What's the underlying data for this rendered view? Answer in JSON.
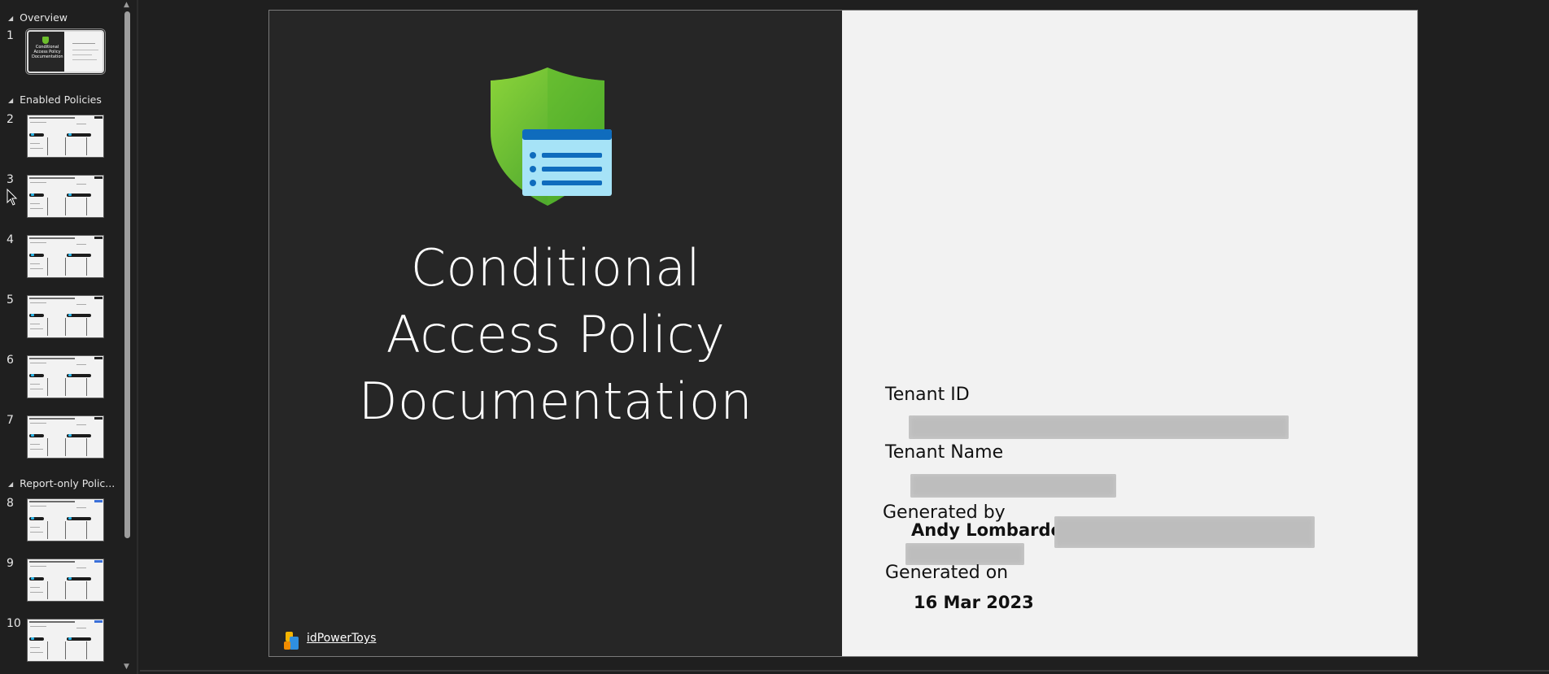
{
  "sidebar": {
    "sections": [
      {
        "label": "Overview"
      },
      {
        "label": "Enabled Policies"
      },
      {
        "label": "Report-only Polic..."
      }
    ],
    "slides": [
      {
        "number": "1",
        "selected": true
      },
      {
        "number": "2"
      },
      {
        "number": "3"
      },
      {
        "number": "4"
      },
      {
        "number": "5"
      },
      {
        "number": "6"
      },
      {
        "number": "7"
      },
      {
        "number": "8"
      },
      {
        "number": "9"
      },
      {
        "number": "10"
      }
    ],
    "first_thumb_title": "Conditional Access Policy Documentation"
  },
  "slide": {
    "title_lines": [
      "Conditional",
      "Access Policy",
      "Documentation"
    ],
    "footer_brand": "idPowerToys",
    "tenant_id_label": "Tenant ID",
    "tenant_name_label": "Tenant Name",
    "generated_by_label": "Generated by",
    "generated_by_value": "Andy Lombardo",
    "generated_on_label": "Generated on",
    "generated_on_value": "16 Mar 2023"
  },
  "colors": {
    "dark_pane": "#262626",
    "light_pane": "#f2f2f2",
    "shield_green": "#6dbf2d",
    "doc_blue": "#0f6cbd",
    "doc_light": "#9fe0f7"
  },
  "icons": [
    "shield-icon",
    "document-list-icon",
    "idpowertoys-logo-icon",
    "mouse-cursor-icon"
  ]
}
